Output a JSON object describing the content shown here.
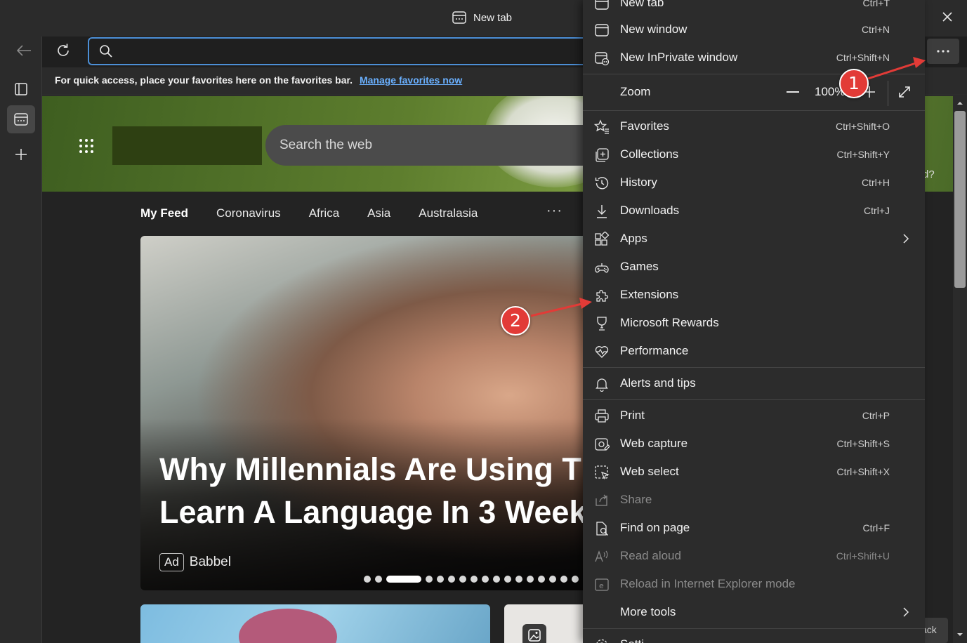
{
  "browser": {
    "tab_title": "New tab",
    "favorites_bar_text": "For quick access, place your favorites here on the favorites bar.",
    "favorites_bar_link": "Manage favorites now"
  },
  "newtab": {
    "search_placeholder": "Search the web",
    "right_fragment": "d?",
    "feed_tabs": [
      "My Feed",
      "Coronavirus",
      "Africa",
      "Asia",
      "Australasia"
    ],
    "feed_more": "···",
    "card_title_line1": "Why Millennials Are Using Th",
    "card_title_line2": "Learn A Language In 3 Week",
    "ad_label": "Ad",
    "ad_source": "Babbel",
    "back_fragment": "ack"
  },
  "menu": {
    "top_partial": {
      "label": "New tab",
      "shortcut": "Ctrl+T"
    },
    "new_window": {
      "label": "New window",
      "shortcut": "Ctrl+N"
    },
    "new_inprivate": {
      "label": "New InPrivate window",
      "shortcut": "Ctrl+Shift+N"
    },
    "zoom": {
      "label": "Zoom",
      "value": "100%"
    },
    "favorites": {
      "label": "Favorites",
      "shortcut": "Ctrl+Shift+O"
    },
    "collections": {
      "label": "Collections",
      "shortcut": "Ctrl+Shift+Y"
    },
    "history": {
      "label": "History",
      "shortcut": "Ctrl+H"
    },
    "downloads": {
      "label": "Downloads",
      "shortcut": "Ctrl+J"
    },
    "apps": {
      "label": "Apps"
    },
    "games": {
      "label": "Games"
    },
    "extensions": {
      "label": "Extensions"
    },
    "rewards": {
      "label": "Microsoft Rewards"
    },
    "performance": {
      "label": "Performance"
    },
    "alerts": {
      "label": "Alerts and tips"
    },
    "print": {
      "label": "Print",
      "shortcut": "Ctrl+P"
    },
    "web_capture": {
      "label": "Web capture",
      "shortcut": "Ctrl+Shift+S"
    },
    "web_select": {
      "label": "Web select",
      "shortcut": "Ctrl+Shift+X"
    },
    "share": {
      "label": "Share"
    },
    "find": {
      "label": "Find on page",
      "shortcut": "Ctrl+F"
    },
    "read_aloud": {
      "label": "Read aloud",
      "shortcut": "Ctrl+Shift+U"
    },
    "ie_mode": {
      "label": "Reload in Internet Explorer mode"
    },
    "more_tools": {
      "label": "More tools"
    },
    "settings_partial": {
      "label": "Setti"
    }
  },
  "annotations": {
    "step1": "1",
    "step2": "2",
    "color": "#e23b37"
  },
  "colors": {
    "accent": "#4c8fd6",
    "link": "#6ab0ff",
    "menu_bg": "#2c2c2c"
  }
}
